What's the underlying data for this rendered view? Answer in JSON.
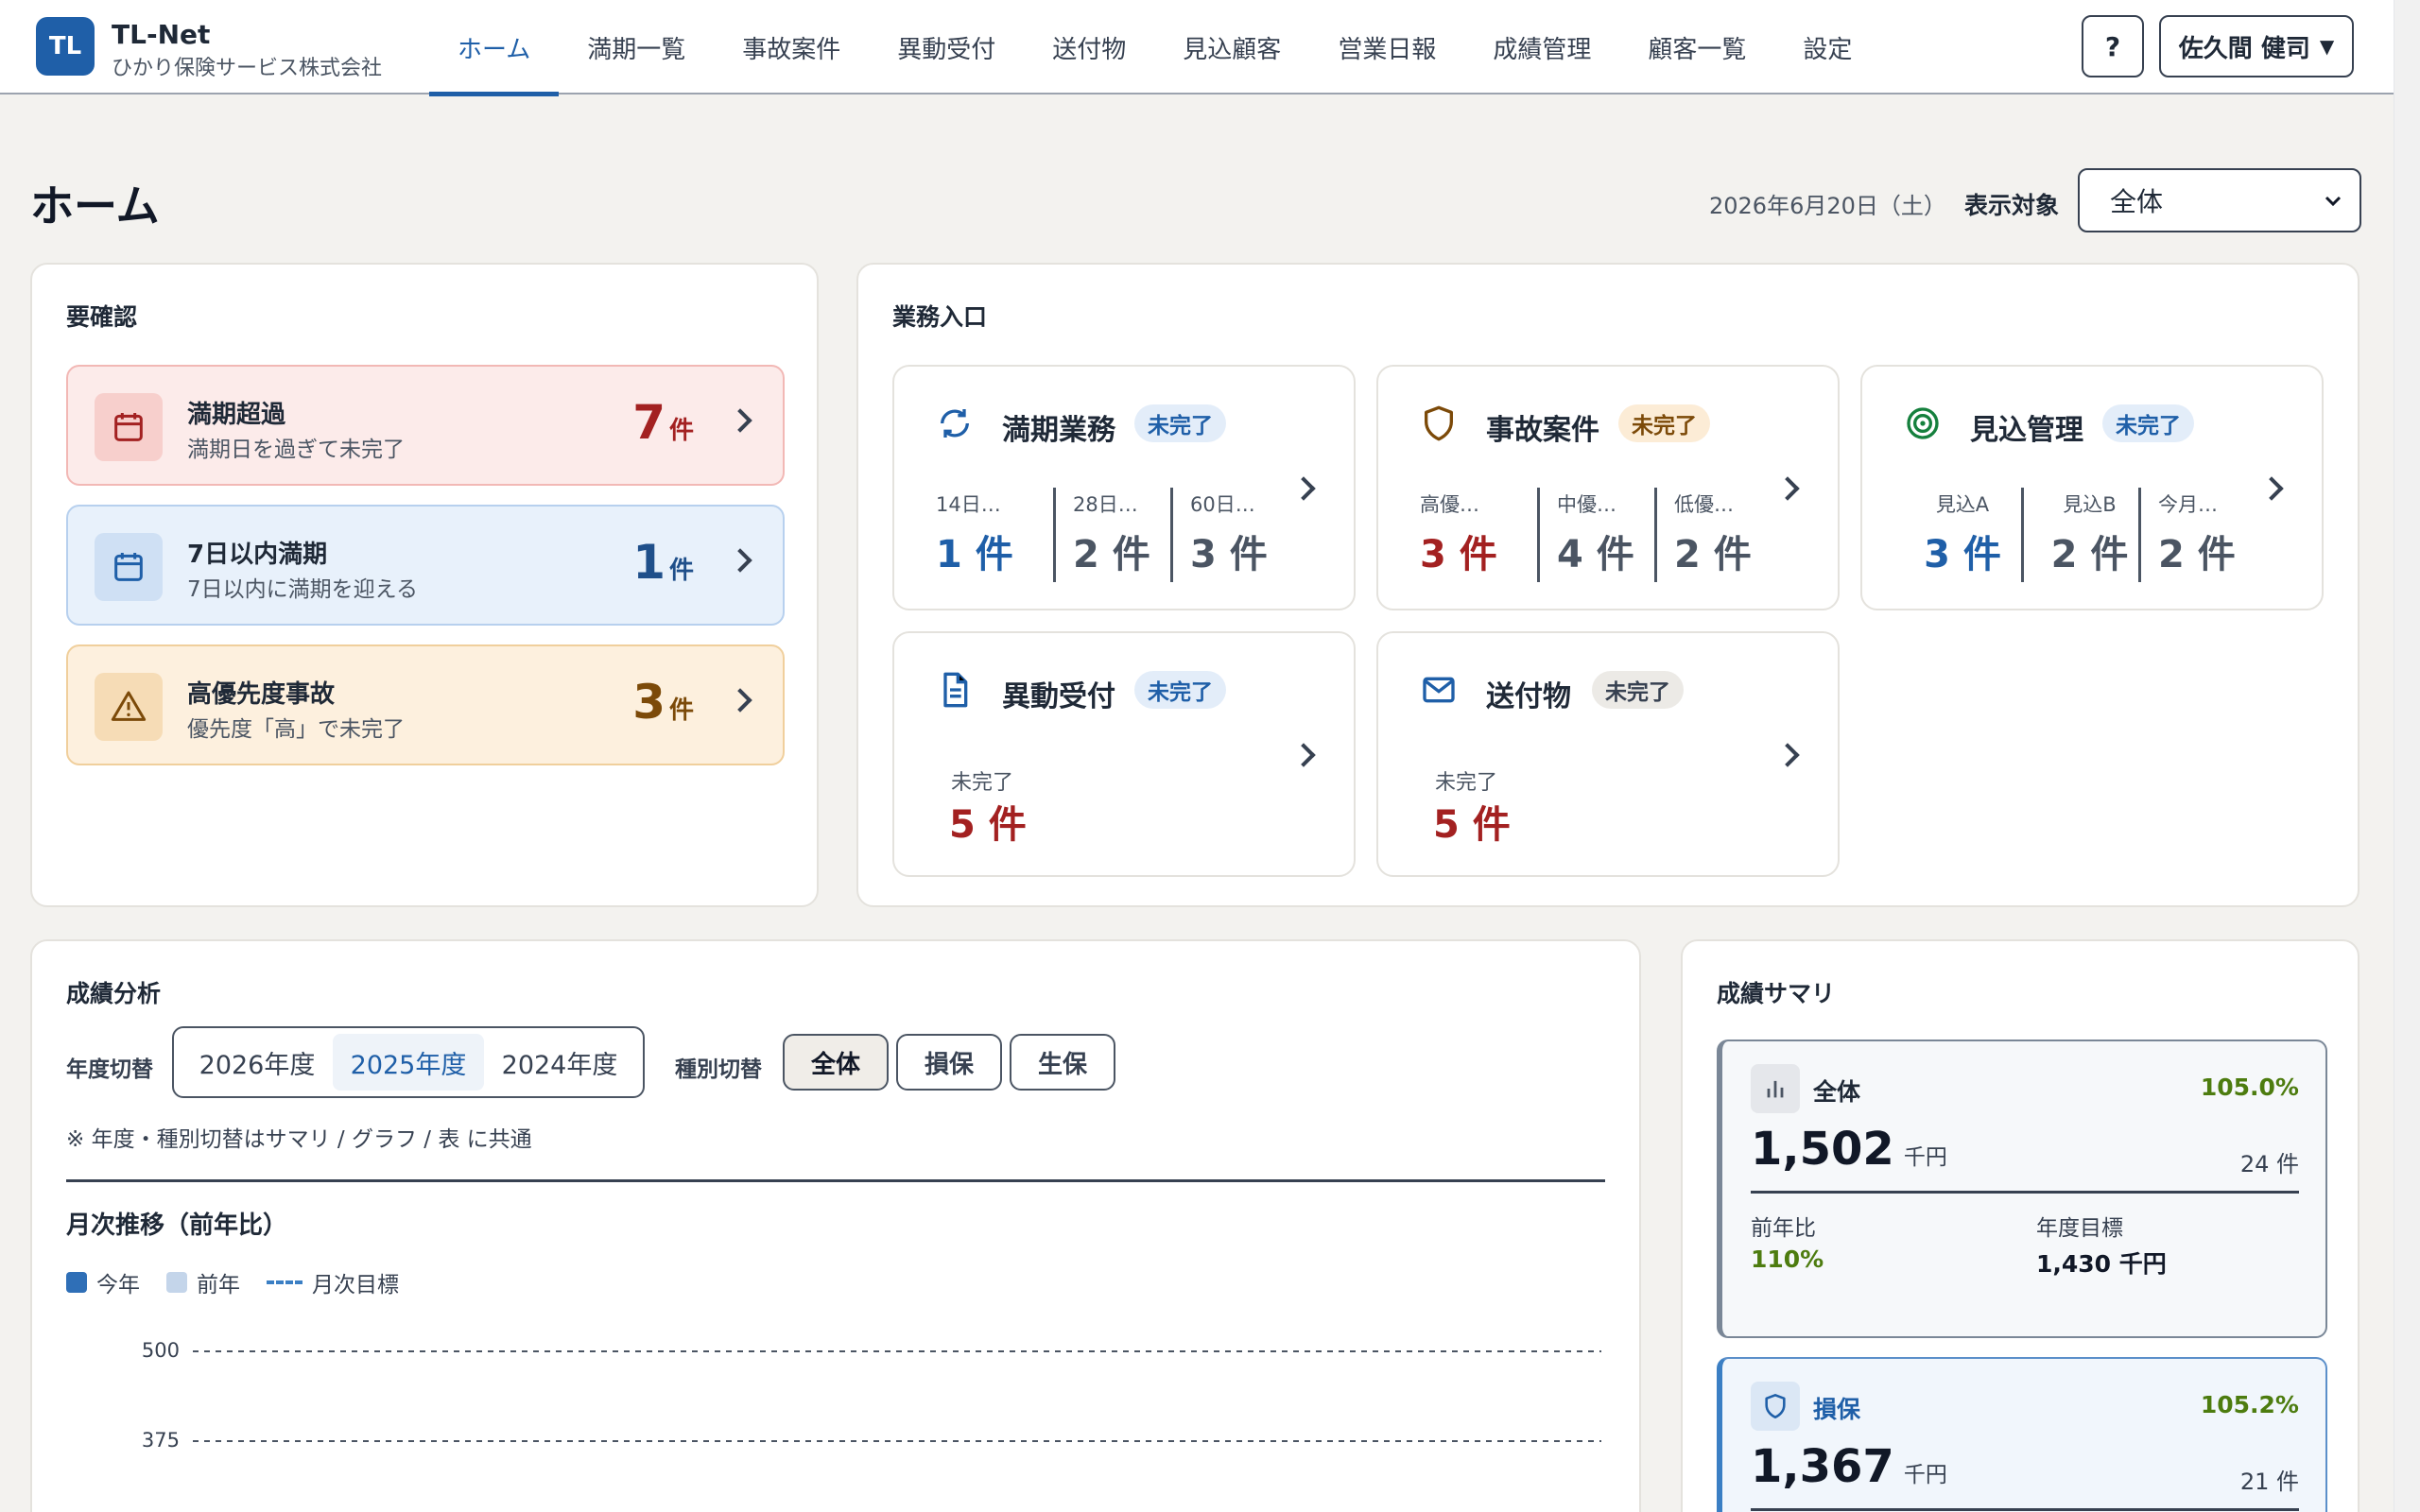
{
  "header": {
    "logo": "TL",
    "app_name": "TL-Net",
    "company": "ひかり保険サービス株式会社",
    "nav": [
      {
        "label": "ホーム"
      },
      {
        "label": "満期一覧"
      },
      {
        "label": "事故案件"
      },
      {
        "label": "異動受付"
      },
      {
        "label": "送付物"
      },
      {
        "label": "見込顧客"
      },
      {
        "label": "営業日報"
      },
      {
        "label": "成績管理"
      },
      {
        "label": "顧客一覧"
      },
      {
        "label": "設定"
      }
    ],
    "help_label": "?",
    "user_name": "佐久間 健司",
    "user_caret": "▼"
  },
  "page": {
    "title": "ホーム",
    "date": "2026年6月20日（土）",
    "scope_label": "表示対象",
    "scope_value": "全体"
  },
  "attention": {
    "title": "要確認",
    "items": [
      {
        "title": "満期超過",
        "sub": "満期日を過ぎて未完了",
        "count": "7",
        "unit": "件",
        "icon": "calendar-icon"
      },
      {
        "title": "7日以内満期",
        "sub": "7日以内に満期を迎える",
        "count": "1",
        "unit": "件",
        "icon": "calendar-icon"
      },
      {
        "title": "高優先度事故",
        "sub": "優先度「高」で未完了",
        "count": "3",
        "unit": "件",
        "icon": "warning-icon"
      }
    ]
  },
  "business": {
    "title": "業務入口",
    "cards": [
      {
        "title": "満期業務",
        "badge": "未完了",
        "icon": "refresh-icon",
        "metrics": [
          {
            "label": "14日…",
            "value": "1 件"
          },
          {
            "label": "28日…",
            "value": "2 件"
          },
          {
            "label": "60日…",
            "value": "3 件"
          }
        ]
      },
      {
        "title": "事故案件",
        "badge": "未完了",
        "icon": "shield-icon",
        "metrics": [
          {
            "label": "高優…",
            "value": "3 件"
          },
          {
            "label": "中優…",
            "value": "4 件"
          },
          {
            "label": "低優…",
            "value": "2 件"
          }
        ]
      },
      {
        "title": "見込管理",
        "badge": "未完了",
        "icon": "target-icon",
        "metrics": [
          {
            "label": "見込A",
            "value": "3 件"
          },
          {
            "label": "見込B",
            "value": "2 件"
          },
          {
            "label": "今月…",
            "value": "2 件"
          }
        ]
      },
      {
        "title": "異動受付",
        "badge": "未完了",
        "icon": "document-icon",
        "label": "未完了",
        "value": "5 件"
      },
      {
        "title": "送付物",
        "badge": "未完了",
        "icon": "mail-icon",
        "label": "未完了",
        "value": "5 件"
      }
    ]
  },
  "analysis": {
    "title": "成績分析",
    "year_label": "年度切替",
    "years": [
      "2026年度",
      "2025年度",
      "2024年度"
    ],
    "type_label": "種別切替",
    "types": [
      "全体",
      "損保",
      "生保"
    ],
    "note": "※ 年度・種別切替はサマリ / グラフ / 表 に共通",
    "chart_title": "月次推移（前年比）",
    "legend": [
      "今年",
      "前年",
      "月次目標"
    ]
  },
  "chart_data": {
    "type": "bar",
    "title": "月次推移（前年比）",
    "series": [
      {
        "name": "今年",
        "values": []
      },
      {
        "name": "前年",
        "values": []
      },
      {
        "name": "月次目標",
        "values": []
      }
    ],
    "yticks": [
      "500",
      "375"
    ],
    "grid": true,
    "legend_position": "top-left"
  },
  "summary": {
    "title": "成績サマリ",
    "cards": [
      {
        "name": "全体",
        "pct": "105.0%",
        "value": "1,502",
        "unit": "千円",
        "count": "24 件",
        "sub1_label": "前年比",
        "sub1_value": "110%",
        "sub2_label": "年度目標",
        "sub2_value": "1,430 千円"
      },
      {
        "name": "損保",
        "pct": "105.2%",
        "value": "1,367",
        "unit": "千円",
        "count": "21 件"
      }
    ]
  },
  "colors": {
    "accent": "#1f5fa8",
    "danger": "#a32121",
    "warning": "#7c4a09",
    "success": "#4d7c0f"
  }
}
